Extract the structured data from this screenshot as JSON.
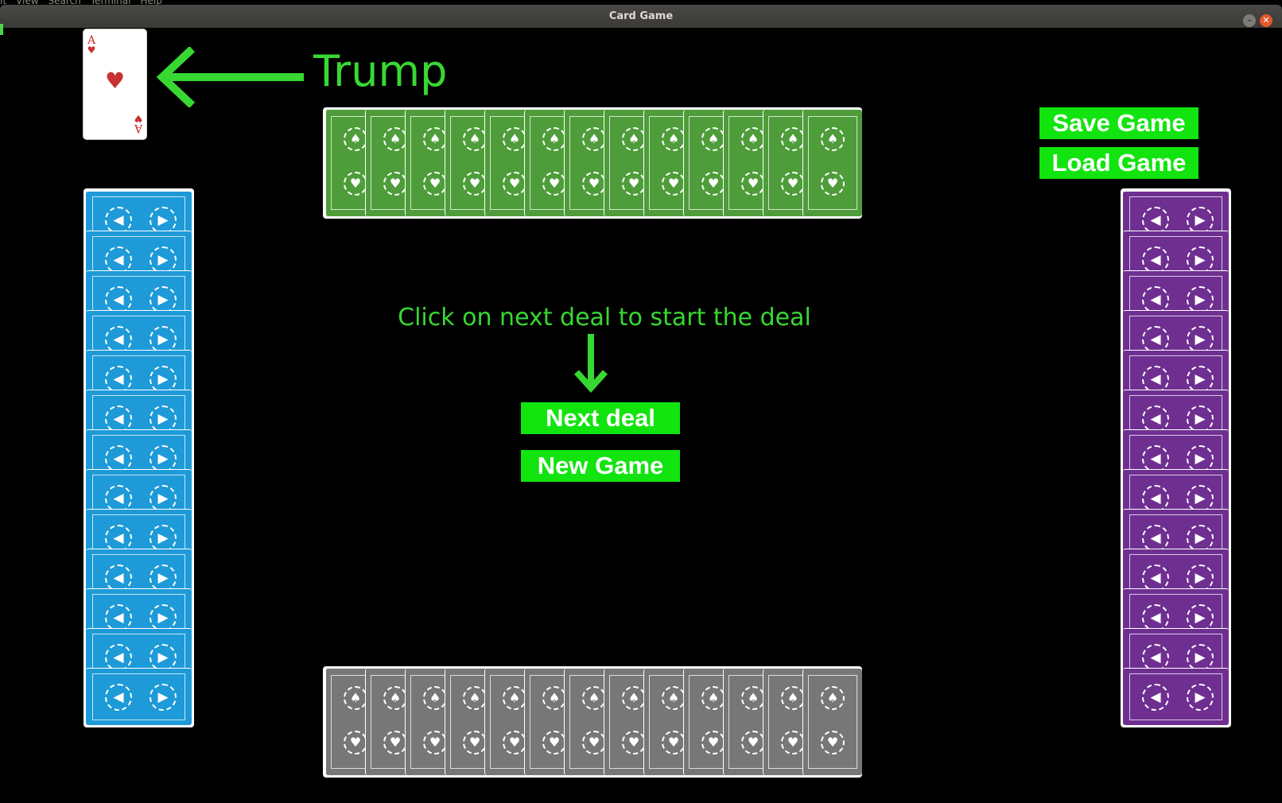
{
  "window": {
    "title": "Card Game",
    "behind_menu": [
      "it",
      "View",
      "Search",
      "Terminal",
      "Help"
    ],
    "close_glyph": "✕",
    "minimize_glyph": "–"
  },
  "trump": {
    "label": "Trump",
    "card": {
      "rank": "A",
      "suit": "♥",
      "suit_color": "#c83232"
    }
  },
  "instruction": "Click on next deal to start the deal",
  "buttons": {
    "next_deal": "Next deal",
    "new_game": "New Game",
    "save_game": "Save Game",
    "load_game": "Load Game"
  },
  "hands": {
    "north": {
      "color": "#4e9d3a",
      "count": 13,
      "orientation": "horizontal"
    },
    "south": {
      "color": "#777777",
      "count": 13,
      "orientation": "horizontal"
    },
    "west": {
      "color": "#1e9ad8",
      "count": 13,
      "orientation": "vertical"
    },
    "east": {
      "color": "#6f2f91",
      "count": 13,
      "orientation": "vertical"
    }
  },
  "colors": {
    "accent_green": "#12e40f",
    "text_green": "#38d832",
    "background": "#000000"
  },
  "icons": {
    "card_back_ornament": "spade-heart-ornament",
    "card_back_ornament_side": "circular-ornament"
  }
}
